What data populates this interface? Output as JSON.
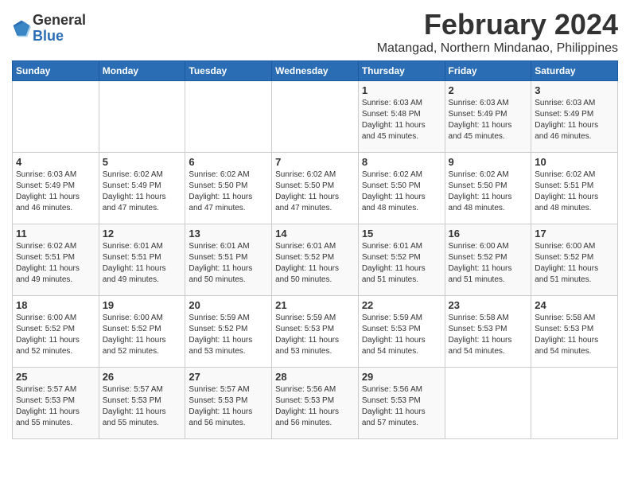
{
  "logo": {
    "general": "General",
    "blue": "Blue"
  },
  "title": {
    "month_year": "February 2024",
    "location": "Matangad, Northern Mindanao, Philippines"
  },
  "weekdays": [
    "Sunday",
    "Monday",
    "Tuesday",
    "Wednesday",
    "Thursday",
    "Friday",
    "Saturday"
  ],
  "weeks": [
    [
      {
        "day": "",
        "info": ""
      },
      {
        "day": "",
        "info": ""
      },
      {
        "day": "",
        "info": ""
      },
      {
        "day": "",
        "info": ""
      },
      {
        "day": "1",
        "info": "Sunrise: 6:03 AM\nSunset: 5:48 PM\nDaylight: 11 hours\nand 45 minutes."
      },
      {
        "day": "2",
        "info": "Sunrise: 6:03 AM\nSunset: 5:49 PM\nDaylight: 11 hours\nand 45 minutes."
      },
      {
        "day": "3",
        "info": "Sunrise: 6:03 AM\nSunset: 5:49 PM\nDaylight: 11 hours\nand 46 minutes."
      }
    ],
    [
      {
        "day": "4",
        "info": "Sunrise: 6:03 AM\nSunset: 5:49 PM\nDaylight: 11 hours\nand 46 minutes."
      },
      {
        "day": "5",
        "info": "Sunrise: 6:02 AM\nSunset: 5:49 PM\nDaylight: 11 hours\nand 47 minutes."
      },
      {
        "day": "6",
        "info": "Sunrise: 6:02 AM\nSunset: 5:50 PM\nDaylight: 11 hours\nand 47 minutes."
      },
      {
        "day": "7",
        "info": "Sunrise: 6:02 AM\nSunset: 5:50 PM\nDaylight: 11 hours\nand 47 minutes."
      },
      {
        "day": "8",
        "info": "Sunrise: 6:02 AM\nSunset: 5:50 PM\nDaylight: 11 hours\nand 48 minutes."
      },
      {
        "day": "9",
        "info": "Sunrise: 6:02 AM\nSunset: 5:50 PM\nDaylight: 11 hours\nand 48 minutes."
      },
      {
        "day": "10",
        "info": "Sunrise: 6:02 AM\nSunset: 5:51 PM\nDaylight: 11 hours\nand 48 minutes."
      }
    ],
    [
      {
        "day": "11",
        "info": "Sunrise: 6:02 AM\nSunset: 5:51 PM\nDaylight: 11 hours\nand 49 minutes."
      },
      {
        "day": "12",
        "info": "Sunrise: 6:01 AM\nSunset: 5:51 PM\nDaylight: 11 hours\nand 49 minutes."
      },
      {
        "day": "13",
        "info": "Sunrise: 6:01 AM\nSunset: 5:51 PM\nDaylight: 11 hours\nand 50 minutes."
      },
      {
        "day": "14",
        "info": "Sunrise: 6:01 AM\nSunset: 5:52 PM\nDaylight: 11 hours\nand 50 minutes."
      },
      {
        "day": "15",
        "info": "Sunrise: 6:01 AM\nSunset: 5:52 PM\nDaylight: 11 hours\nand 51 minutes."
      },
      {
        "day": "16",
        "info": "Sunrise: 6:00 AM\nSunset: 5:52 PM\nDaylight: 11 hours\nand 51 minutes."
      },
      {
        "day": "17",
        "info": "Sunrise: 6:00 AM\nSunset: 5:52 PM\nDaylight: 11 hours\nand 51 minutes."
      }
    ],
    [
      {
        "day": "18",
        "info": "Sunrise: 6:00 AM\nSunset: 5:52 PM\nDaylight: 11 hours\nand 52 minutes."
      },
      {
        "day": "19",
        "info": "Sunrise: 6:00 AM\nSunset: 5:52 PM\nDaylight: 11 hours\nand 52 minutes."
      },
      {
        "day": "20",
        "info": "Sunrise: 5:59 AM\nSunset: 5:52 PM\nDaylight: 11 hours\nand 53 minutes."
      },
      {
        "day": "21",
        "info": "Sunrise: 5:59 AM\nSunset: 5:53 PM\nDaylight: 11 hours\nand 53 minutes."
      },
      {
        "day": "22",
        "info": "Sunrise: 5:59 AM\nSunset: 5:53 PM\nDaylight: 11 hours\nand 54 minutes."
      },
      {
        "day": "23",
        "info": "Sunrise: 5:58 AM\nSunset: 5:53 PM\nDaylight: 11 hours\nand 54 minutes."
      },
      {
        "day": "24",
        "info": "Sunrise: 5:58 AM\nSunset: 5:53 PM\nDaylight: 11 hours\nand 54 minutes."
      }
    ],
    [
      {
        "day": "25",
        "info": "Sunrise: 5:57 AM\nSunset: 5:53 PM\nDaylight: 11 hours\nand 55 minutes."
      },
      {
        "day": "26",
        "info": "Sunrise: 5:57 AM\nSunset: 5:53 PM\nDaylight: 11 hours\nand 55 minutes."
      },
      {
        "day": "27",
        "info": "Sunrise: 5:57 AM\nSunset: 5:53 PM\nDaylight: 11 hours\nand 56 minutes."
      },
      {
        "day": "28",
        "info": "Sunrise: 5:56 AM\nSunset: 5:53 PM\nDaylight: 11 hours\nand 56 minutes."
      },
      {
        "day": "29",
        "info": "Sunrise: 5:56 AM\nSunset: 5:53 PM\nDaylight: 11 hours\nand 57 minutes."
      },
      {
        "day": "",
        "info": ""
      },
      {
        "day": "",
        "info": ""
      }
    ]
  ]
}
